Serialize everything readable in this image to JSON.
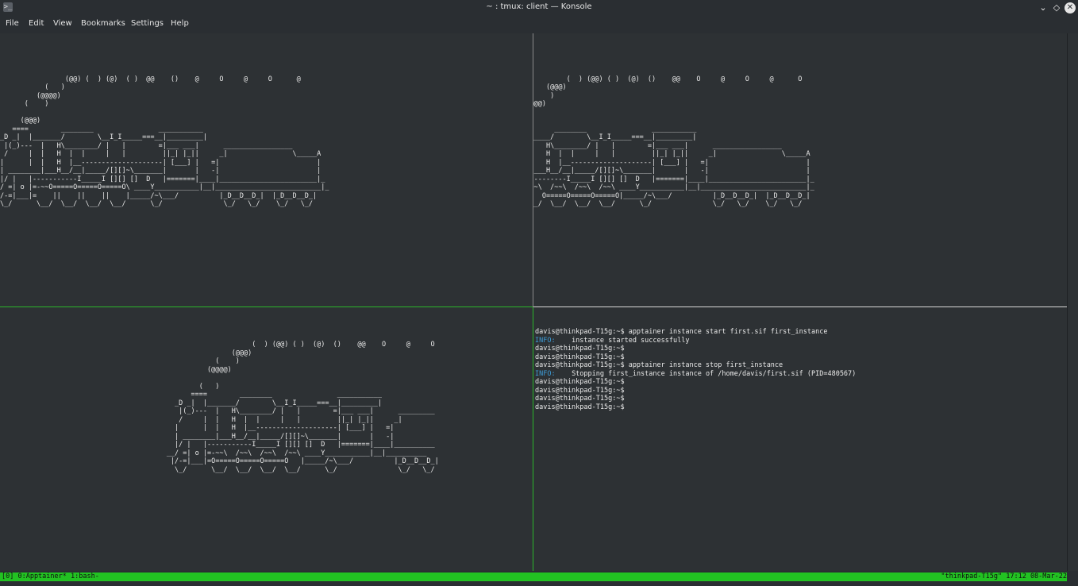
{
  "window": {
    "title": "~ : tmux: client — Konsole",
    "app_icon": "terminal-icon",
    "controls": {
      "minimize": "⌄",
      "float": "◇",
      "close": "✕"
    }
  },
  "menu": [
    "File",
    "Edit",
    "View",
    "Bookmarks",
    "Settings",
    "Help"
  ],
  "panes": {
    "top_left": "\n\n\n\n\n                (@@) (  ) (@)  ( )  @@    ()    @     O     @     O      @\n           (   )\n         (@@@@)\n      (    )\n\n     (@@@)\n   ====        ________                ___________\n_D _|  |_______/        \\__I_I_____===__|_________|\n |(_)---  |   H\\________/ |   |        =|___ ___|      _________________\n /     |  |   H  |  |     |   |         ||_| |_||     _|                \\_____A\n|      |  |   H  |__--------------------| [___] |   =|                        |\n| ________|___H__/__|_____/[][]~\\_______|       |   -|                        |\n|/ |   |-----------I_____I [][] []  D   |=======|____|________________________|_\n/ =| o |=-~~O=====O=====O=====O\\ ____Y___________|__|__________________________|_\n/-=|___|=    ||    ||    ||    |_____/~\\___/          |_D__D__D_|  |_D__D__D_|\n\\_/      \\__/  \\__/  \\__/  \\__/      \\_/               \\_/   \\_/    \\_/   \\_/",
    "top_right": "\n\n\n\n\n                                                                         (  ) (@@) ( )  (@)  ()    @@    O     @     O     @      O\n                                                                    (@@@)\n                                                                (    )\n                                                              (@@@@)\n\n                                                            (   )\n                                                          ====        ________                ___________\n                                                      _D _|  |_______/        \\__I_I_____===__|_________|\n                                                       |(_)---  |   H\\________/ |   |        =|___ ___|      _________________\n                                                       /     |  |   H  |  |     |   |         ||_| |_||     _|                \\_____A\n                                                      |      |  |   H  |__--------------------| [___] |   =|                        |\n                                                      | ________|___H__/__|_____/[][]~\\_______|       |   -|                        |\n                                                      |/ |   |-----------I_____I [][] []  D   |=======|____|________________________|_\n                                                    __/ =| o |=-~~\\  /~~\\  /~~\\  /~~\\ ____Y___________|__|__________________________|_\n                                                     |/-=|___|=    O=====O=====O=====O|_____/~\\___/          |_D__D__D_|  |_D__D__D_|\n                                                      \\_/      \\__/  \\__/  \\__/  \\__/      \\_/               \\_/   \\_/    \\_/   \\_/",
    "bottom_left": "\n\n\n\n                                                              (  ) (@@) ( )  (@)  ()    @@    O     @     O\n                                                         (@@@)\n                                                     (    )\n                                                   (@@@@)\n\n                                                 (   )\n                                               ====        ________                ___________\n                                           _D _|  |_______/        \\__I_I_____===__|_________|\n                                            |(_)---  |   H\\________/ |   |        =|___ ___|      _________\n                                            /     |  |   H  |  |     |   |         ||_| |_||     _|\n                                           |      |  |   H  |__--------------------| [___] |   =|\n                                           | ________|___H__/__|_____/[][]~\\_______|       |   -|\n                                           |/ |   |-----------I_____I [][] []  D   |=======|____|__________\n                                         __/ =| o |=-~~\\  /~~\\  /~~\\  /~~\\ ____Y___________|__|__________\n                                          |/-=|___|=O=====O=====O=====O   |_____/~\\___/          |_D__D__D_|\n                                           \\_/      \\__/  \\__/  \\__/  \\__/      \\_/               \\_/   \\_/",
    "bottom_right": [
      {
        "text": "davis@thinkpad-T15g:~$ apptainer instance start first.sif first_instance"
      },
      {
        "prefix": "INFO:",
        "text": "    instance started successfully"
      },
      {
        "text": "davis@thinkpad-T15g:~$"
      },
      {
        "text": "davis@thinkpad-T15g:~$"
      },
      {
        "text": "davis@thinkpad-T15g:~$ apptainer instance stop first_instance"
      },
      {
        "prefix": "INFO:",
        "text": "    Stopping first_instance instance of /home/davis/first.sif (PID=480567)"
      },
      {
        "text": "davis@thinkpad-T15g:~$"
      },
      {
        "text": "davis@thinkpad-T15g:~$"
      },
      {
        "text": "davis@thinkpad-T15g:~$"
      },
      {
        "text": "davis@thinkpad-T15g:~$"
      }
    ]
  },
  "statusbar": {
    "left": "[0] 0:Apptainer* 1:bash-",
    "right": "\"thinkpad-T15g\" 17:12 08-Mar-22"
  },
  "colors": {
    "status_green": "#22c222",
    "active_border": "#2bb52b",
    "info_blue": "#3d9bd6"
  }
}
